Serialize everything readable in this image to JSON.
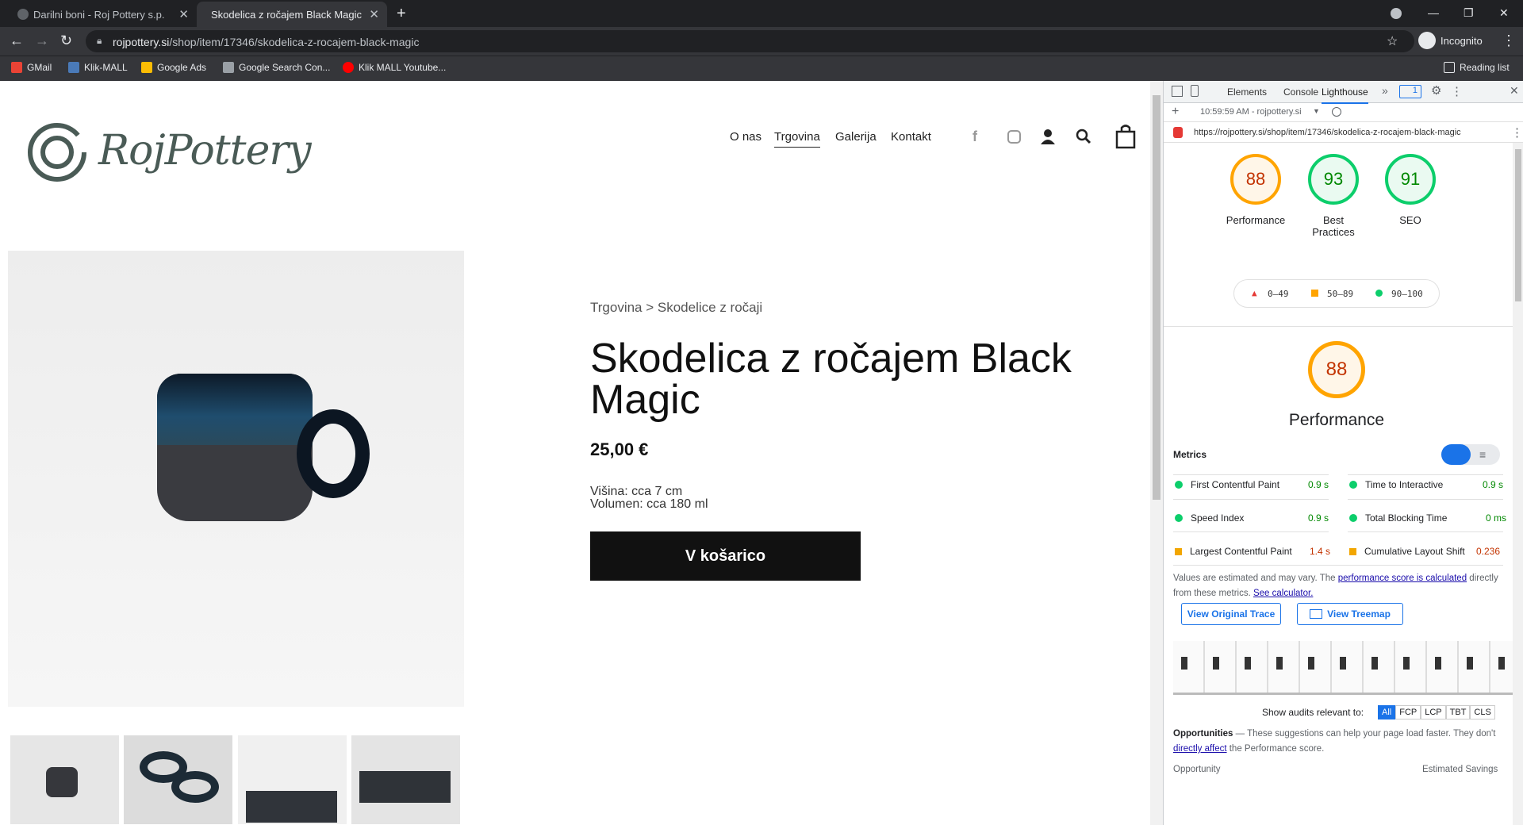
{
  "browser": {
    "tabs": [
      {
        "title": "Darilni boni - Roj Pottery s.p."
      },
      {
        "title": "Skodelica z ročajem Black Magic"
      }
    ],
    "url_domain": "rojpottery.si",
    "url_path": "/shop/item/17346/skodelica-z-rocajem-black-magic",
    "profile": "Incognito",
    "bookmarks": [
      "GMail",
      "Klik-MALL",
      "Google Ads",
      "Google Search Con...",
      "Klik MALL Youtube..."
    ],
    "reading_list": "Reading list"
  },
  "site": {
    "logo_text": "RojPottery",
    "nav": [
      "O nas",
      "Trgovina",
      "Galerija",
      "Kontakt"
    ],
    "breadcrumb": "Trgovina > Skodelice z ročaji",
    "product_title": "Skodelica z ročajem Black Magic",
    "price": "25,00 €",
    "desc_height": "Višina: cca 7 cm",
    "desc_volume": "Volumen: cca 180 ml",
    "add_to_cart": "V košarico"
  },
  "devtools": {
    "tabs": [
      "Elements",
      "Console",
      "Lighthouse"
    ],
    "badge": "1",
    "report_time": "10:59:59 AM - rojpottery.si",
    "report_url": "https://rojpottery.si/shop/item/17346/skodelica-z-rocajem-black-magic",
    "scores": [
      {
        "value": "88",
        "label": "Performance",
        "color": "#ffa400"
      },
      {
        "value": "93",
        "label": "Best Practices",
        "color": "#0cce6b"
      },
      {
        "value": "91",
        "label": "SEO",
        "color": "#0cce6b"
      }
    ],
    "legend": [
      "0–49",
      "50–89",
      "90–100"
    ],
    "big_score": "88",
    "big_label": "Performance",
    "metrics_title": "Metrics",
    "metrics": [
      {
        "name": "First Contentful Paint",
        "value": "0.9 s",
        "status": "pass"
      },
      {
        "name": "Time to Interactive",
        "value": "0.9 s",
        "status": "pass"
      },
      {
        "name": "Speed Index",
        "value": "0.9 s",
        "status": "pass"
      },
      {
        "name": "Total Blocking Time",
        "value": "0 ms",
        "status": "pass"
      },
      {
        "name": "Largest Contentful Paint",
        "value": "1.4 s",
        "status": "average"
      },
      {
        "name": "Cumulative Layout Shift",
        "value": "0.236",
        "status": "average"
      }
    ],
    "note_prefix": "Values are estimated and may vary. The ",
    "note_link1": "performance score is calculated",
    "note_mid": " directly from these metrics. ",
    "note_link2": "See calculator.",
    "btn_trace": "View Original Trace",
    "btn_treemap": "View Treemap",
    "audits_label": "Show audits relevant to:",
    "audit_filters": [
      "All",
      "FCP",
      "LCP",
      "TBT",
      "CLS"
    ],
    "opps_title": "Opportunities",
    "opps_text1": " — These suggestions can help your page load faster. They don't ",
    "opps_link": "directly affect",
    "opps_text2": " the Performance score.",
    "col_opportunity": "Opportunity",
    "col_savings": "Estimated Savings"
  }
}
